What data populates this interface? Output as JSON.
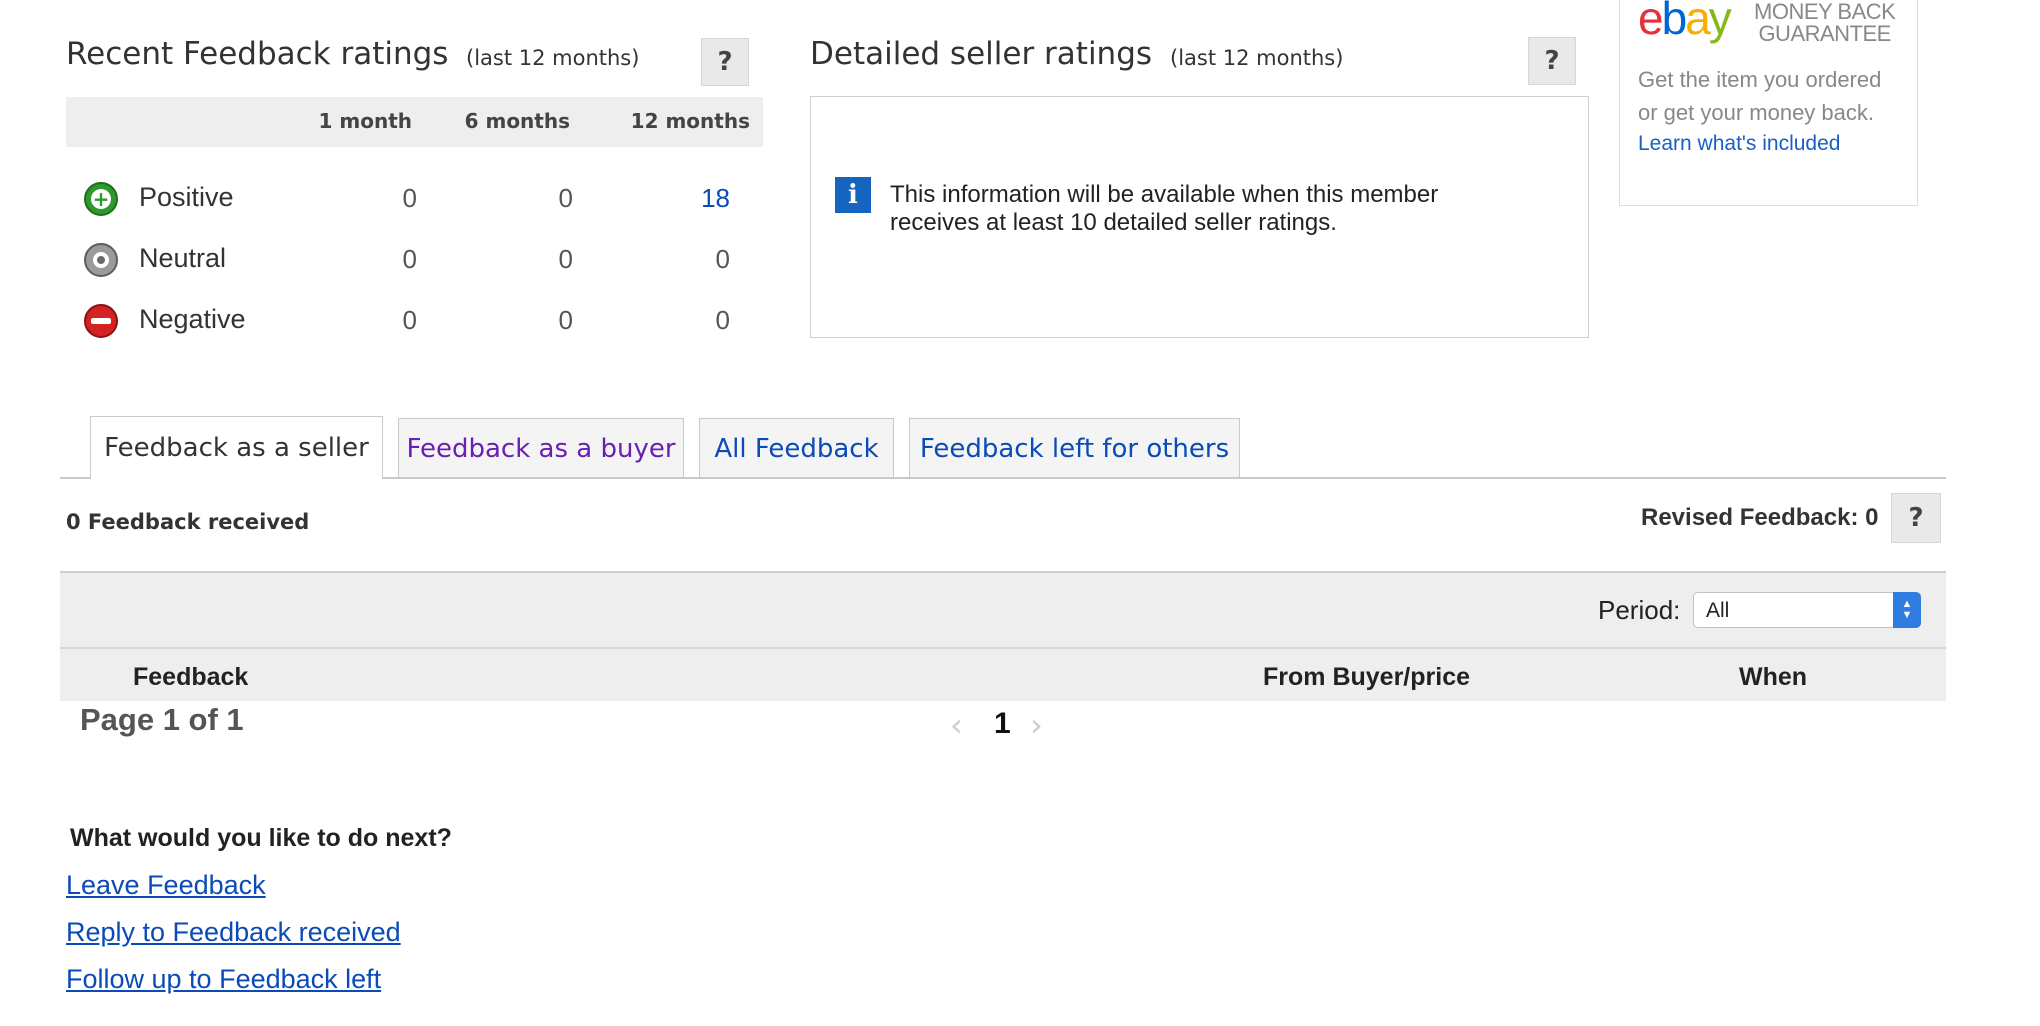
{
  "recent": {
    "title": "Recent Feedback ratings",
    "subtitle": "(last 12 months)",
    "help": "?",
    "columns": [
      "1 month",
      "6 months",
      "12 months"
    ],
    "rows": [
      {
        "label": "Positive",
        "icon": "positive-icon",
        "values": [
          "0",
          "0",
          "18"
        ]
      },
      {
        "label": "Neutral",
        "icon": "neutral-icon",
        "values": [
          "0",
          "0",
          "0"
        ]
      },
      {
        "label": "Negative",
        "icon": "negative-icon",
        "values": [
          "0",
          "0",
          "0"
        ]
      }
    ]
  },
  "detailed": {
    "title": "Detailed seller ratings",
    "subtitle": "(last 12 months)",
    "help": "?",
    "info_line1": "This information will be available when this member",
    "info_line2": "receives at least 10 detailed seller ratings."
  },
  "guarantee": {
    "logo": "ebay",
    "line1": "MONEY BACK",
    "line2": "GUARANTEE",
    "text1": "Get the item you ordered",
    "text2": "or get your money back.",
    "link": "Learn what's included"
  },
  "tabs": [
    {
      "label": "Feedback as a seller",
      "active": true
    },
    {
      "label": "Feedback as a buyer",
      "active": false
    },
    {
      "label": "All Feedback",
      "active": false
    },
    {
      "label": "Feedback left for others",
      "active": false
    }
  ],
  "summary": {
    "received": "0 Feedback received",
    "revised": "Revised Feedback: 0",
    "help": "?"
  },
  "filter": {
    "period_label": "Period:",
    "period_value": "All"
  },
  "table": {
    "headers": [
      "Feedback",
      "From Buyer/price",
      "When"
    ]
  },
  "pagination": {
    "page_text": "Page 1 of 1",
    "current": "1"
  },
  "next": {
    "heading": "What would you like to do next?",
    "links": [
      "Leave Feedback",
      "Reply to Feedback received",
      "Follow up to Feedback left"
    ]
  },
  "colors": {
    "link": "#0a4bb7",
    "visited_link": "#6a1fb3",
    "info_blue": "#1565c0",
    "positive_green": "#2e9a2e",
    "negative_red": "#d32222"
  }
}
